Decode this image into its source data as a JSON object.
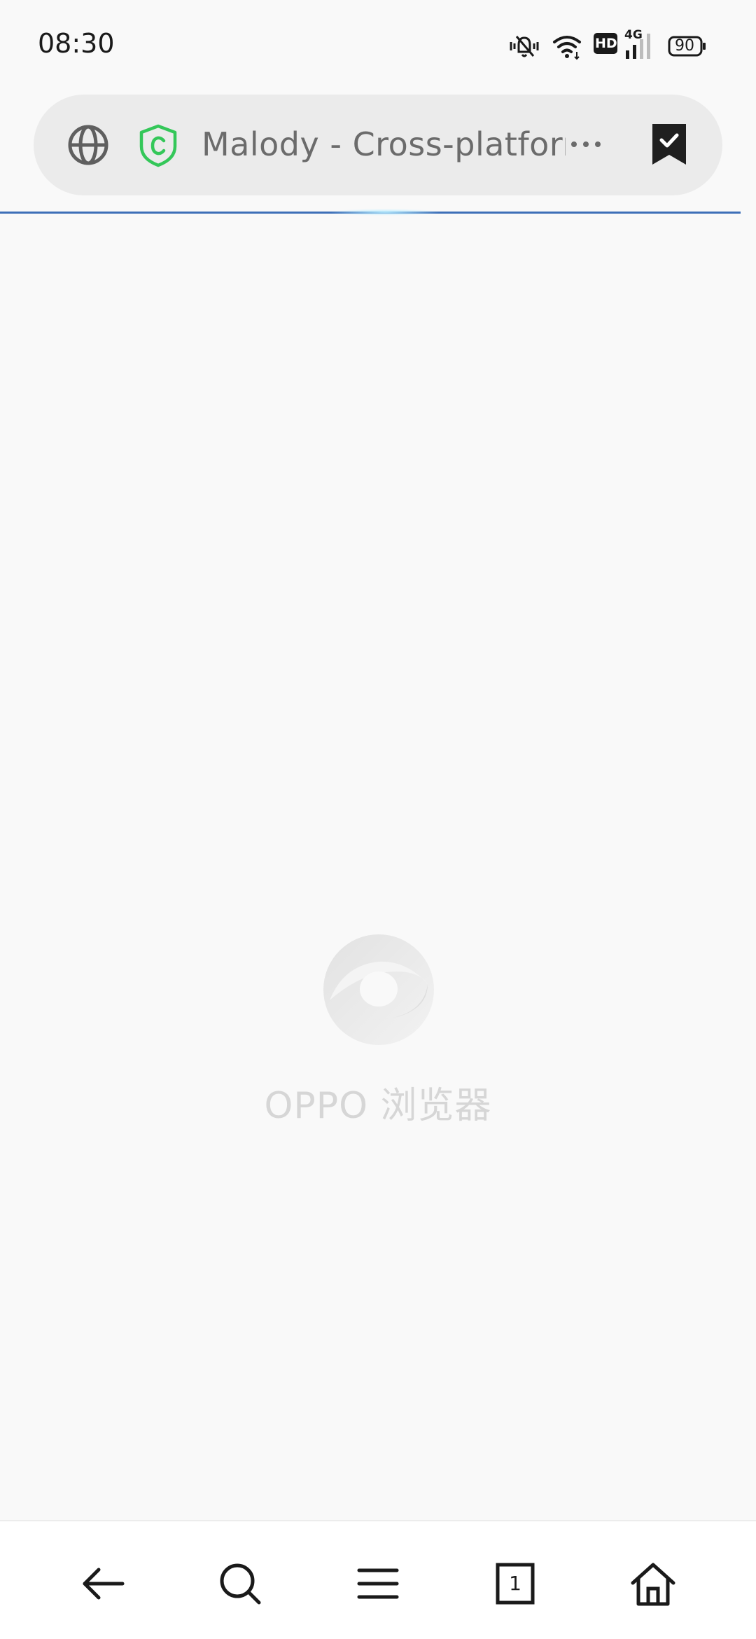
{
  "status_bar": {
    "time": "08:30",
    "battery": "90",
    "network": "4G",
    "hd_label": "HD"
  },
  "address_bar": {
    "title": "Malody - Cross-platform",
    "icons": [
      "globe-icon",
      "shield-icon",
      "more-icon",
      "bookmark-icon"
    ],
    "secure_color": "#34c759"
  },
  "loading": {
    "progress_color": "#3d6fb8"
  },
  "splash": {
    "brand": "OPPO 浏览器"
  },
  "bottom_nav": {
    "tab_count": "1",
    "items": [
      "back-icon",
      "search-icon",
      "menu-icon",
      "tabs-icon",
      "home-icon"
    ]
  }
}
